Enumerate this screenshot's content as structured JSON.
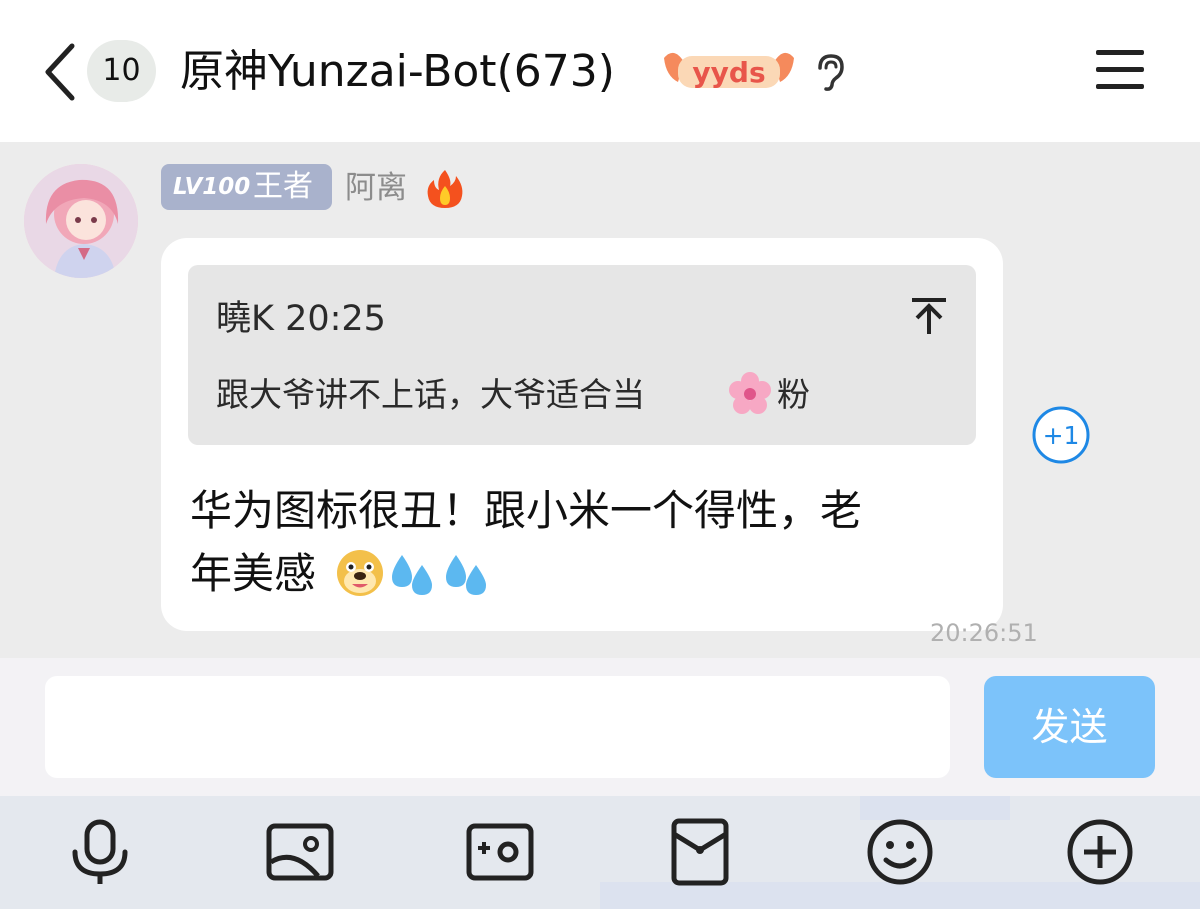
{
  "header": {
    "unread_count": "10",
    "group_title": "原神Yunzai-Bot(673)",
    "badge_text": "yyds"
  },
  "message": {
    "level_label": "LV100",
    "rank_label": "王者",
    "sender_name": "阿离",
    "quote": {
      "author_time": "曉K 20:25",
      "text_before_flower": "跟大爷讲不上话，大爷适合当",
      "text_after_flower": "粉"
    },
    "body_line1": "华为图标很丑！跟小米一个得性，老",
    "body_line2": "年美感",
    "plus_one": "+1",
    "timestamp": "20:26:51"
  },
  "composer": {
    "input_value": "",
    "send_label": "发送"
  },
  "toolbar": {
    "icons": [
      "microphone-icon",
      "image-icon",
      "camera-icon",
      "red-packet-icon",
      "emoji-icon",
      "plus-icon"
    ]
  },
  "colors": {
    "send_button": "#7cc3fa",
    "plus_one_accent": "#1e88e5",
    "level_tag": "#a9b2cc",
    "background": "#ececec"
  }
}
